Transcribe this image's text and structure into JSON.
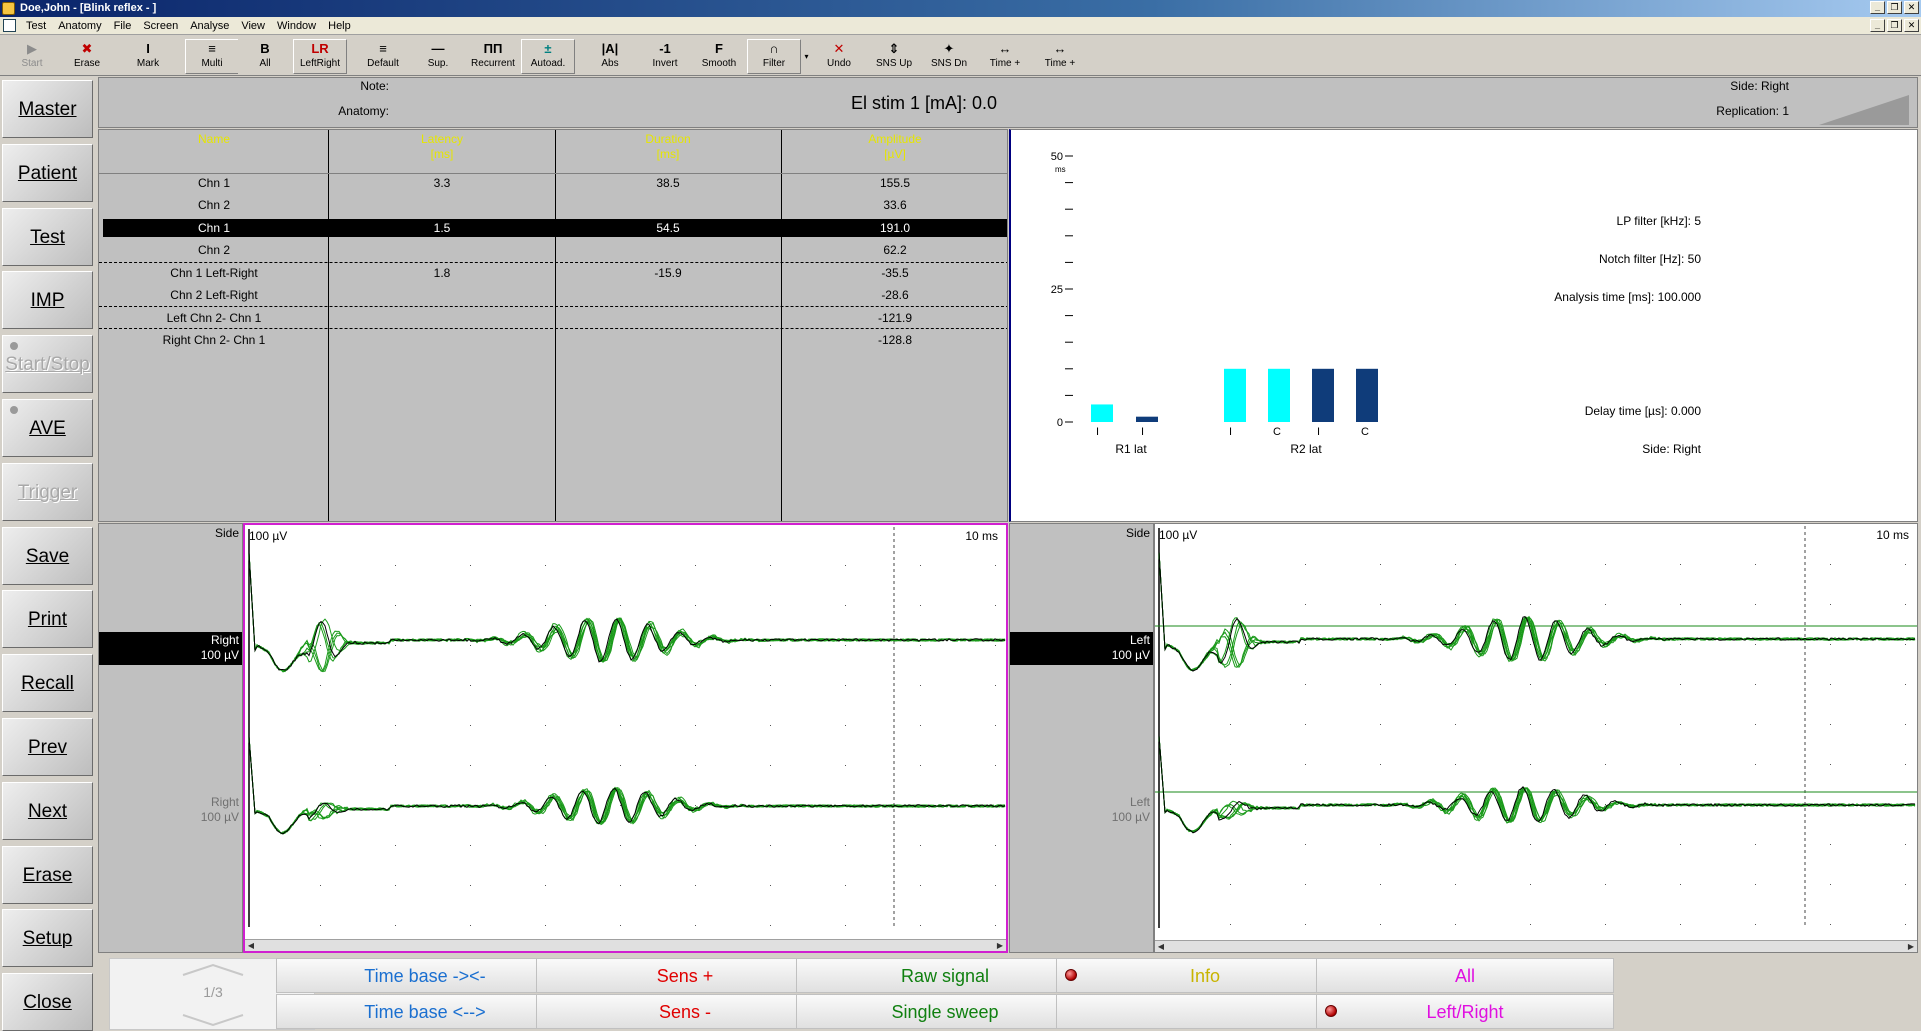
{
  "window": {
    "title": "Doe,John - [Blink reflex - ]"
  },
  "menu": [
    "Test",
    "Anatomy",
    "File",
    "Screen",
    "Analyse",
    "View",
    "Window",
    "Help"
  ],
  "toolbar": [
    {
      "icon": "▶",
      "label": "Start",
      "disabled": true,
      "color": "#8c8c8c"
    },
    {
      "icon": "✖",
      "label": "Erase",
      "color": "#c00000"
    },
    {
      "icon": "I",
      "label": "Mark",
      "color": "#000"
    },
    {
      "icon": "≡",
      "label": "Multi",
      "color": "#000",
      "raised": true
    },
    {
      "icon": "B",
      "label": "All",
      "color": "#000"
    },
    {
      "icon": "LR",
      "label": "LeftRight",
      "color": "#c00000",
      "raised": true
    },
    {
      "icon": "≡",
      "label": "Default",
      "color": "#000"
    },
    {
      "icon": "—",
      "label": "Sup.",
      "color": "#000"
    },
    {
      "icon": "ΠΠ",
      "label": "Recurrent",
      "color": "#000"
    },
    {
      "icon": "±",
      "label": "Autoad.",
      "color": "#008080",
      "raised": true
    },
    {
      "icon": "|A|",
      "label": "Abs",
      "color": "#000"
    },
    {
      "icon": "-1",
      "label": "Invert",
      "color": "#000"
    },
    {
      "icon": "F",
      "label": "Smooth",
      "color": "#000"
    },
    {
      "icon": "∩",
      "label": "Filter",
      "color": "#000",
      "raised": true
    },
    {
      "icon": "✕",
      "label": "Undo",
      "color": "#c00000"
    },
    {
      "icon": "⇕",
      "label": "SNS Up",
      "color": "#000"
    },
    {
      "icon": "✦",
      "label": "SNS Dn",
      "color": "#000"
    },
    {
      "icon": "↔",
      "label": "Time +",
      "color": "#000"
    },
    {
      "icon": "↔",
      "label": "Time +",
      "color": "#000"
    }
  ],
  "side_buttons": [
    {
      "label": "Master",
      "disabled": false,
      "led": false
    },
    {
      "label": "Patient",
      "disabled": false,
      "led": false
    },
    {
      "label": "Test",
      "disabled": false,
      "led": false
    },
    {
      "label": "IMP",
      "disabled": false,
      "led": false
    },
    {
      "label": "Start/Stop",
      "disabled": true,
      "led": true
    },
    {
      "label": "AVE",
      "disabled": false,
      "led": true
    },
    {
      "label": "Trigger",
      "disabled": true,
      "led": false
    },
    {
      "label": "Save",
      "disabled": false,
      "led": false
    },
    {
      "label": "Print",
      "disabled": false,
      "led": false
    },
    {
      "label": "Recall",
      "disabled": false,
      "led": false
    },
    {
      "label": "Prev",
      "disabled": false,
      "led": false
    },
    {
      "label": "Next",
      "disabled": false,
      "led": false
    },
    {
      "label": "Erase",
      "disabled": false,
      "led": false
    },
    {
      "label": "Setup",
      "disabled": false,
      "led": false
    },
    {
      "label": "Close",
      "disabled": false,
      "led": false
    }
  ],
  "header": {
    "note_label": "Note:",
    "anatomy_label": "Anatomy:",
    "stimulus": "El stim 1 [mA]: 0.0",
    "side": "Side: Right",
    "replication": "Replication: 1"
  },
  "table": {
    "headers": [
      {
        "line1": "Name",
        "line2": ""
      },
      {
        "line1": "Latency",
        "line2": "[ms]"
      },
      {
        "line1": "Duration",
        "line2": "[ms]"
      },
      {
        "line1": "Amplitude",
        "line2": "[µV]"
      }
    ],
    "rows": [
      {
        "name": "Chn 1",
        "latency": "3.3",
        "duration": "38.5",
        "amplitude": "155.5",
        "selected": false
      },
      {
        "name": "Chn 2",
        "latency": "",
        "duration": "",
        "amplitude": "33.6",
        "selected": false
      },
      {
        "name": "Chn 1",
        "latency": "1.5",
        "duration": "54.5",
        "amplitude": "191.0",
        "selected": true
      },
      {
        "name": "Chn 2",
        "latency": "",
        "duration": "",
        "amplitude": "62.2",
        "selected": false
      },
      {
        "name": "Chn 1  Left-Right",
        "latency": "1.8",
        "duration": "-15.9",
        "amplitude": "-35.5",
        "selected": false
      },
      {
        "name": "Chn 2  Left-Right",
        "latency": "",
        "duration": "",
        "amplitude": "-28.6",
        "selected": false
      },
      {
        "name": "Left  Chn 2- Chn 1",
        "latency": "",
        "duration": "",
        "amplitude": "-121.9",
        "selected": false
      },
      {
        "name": "Right  Chn 2- Chn 1",
        "latency": "",
        "duration": "",
        "amplitude": "-128.8",
        "selected": false
      }
    ]
  },
  "bar_chart": {
    "y_unit": "ms",
    "y_ticks": [
      0,
      25,
      50
    ],
    "bars": [
      {
        "tick": "I",
        "value": 3.3,
        "color": "#00ffff"
      },
      {
        "tick": "I",
        "value": 1.0,
        "color": "#0f3c7a"
      },
      {
        "tick": "I",
        "value": 10.0,
        "color": "#00ffff"
      },
      {
        "tick": "C",
        "value": 10.0,
        "color": "#00ffff"
      },
      {
        "tick": "I",
        "value": 10.0,
        "color": "#0f3c7a"
      },
      {
        "tick": "C",
        "value": 10.0,
        "color": "#0f3c7a"
      }
    ],
    "group_labels": [
      "R1 lat",
      "R2 lat"
    ]
  },
  "info": {
    "lp_filter": "LP filter [kHz]: 5",
    "notch_filter": "Notch filter [Hz]: 50",
    "analysis_time": "Analysis time [ms]: 100.000",
    "delay_time": "Delay time [µs]: 0.000",
    "side": "Side: Right"
  },
  "traces": {
    "left": {
      "side_header": "Side",
      "ch1_label_side": "Right",
      "ch1_label_sens": "100 µV",
      "ch2_label_side": "Right",
      "ch2_label_sens": "100 µV",
      "scale_label": "100 µV",
      "time_label": "10 ms"
    },
    "right": {
      "side_header": "Side",
      "ch1_label_side": "Left",
      "ch1_label_sens": "100 µV",
      "ch2_label_side": "Left",
      "ch2_label_sens": "100 µV",
      "scale_label": "100 µV",
      "time_label": "10 ms"
    },
    "colors": {
      "trace": "#1a9a1a",
      "average": "#000000",
      "baseline": "#1a8a1a",
      "active_border": "#d020d0"
    }
  },
  "page": {
    "indicator": "1/3"
  },
  "function_keys": [
    {
      "label": "Time base -><-",
      "color": "#1a6fd0",
      "led": false
    },
    {
      "label": "Time base <-->",
      "color": "#1a6fd0",
      "led": false
    },
    {
      "label": "Sens +",
      "color": "#e00000",
      "led": false
    },
    {
      "label": "Sens -",
      "color": "#e00000",
      "led": false
    },
    {
      "label": "Raw signal",
      "color": "#108010",
      "led": false
    },
    {
      "label": "Single sweep",
      "color": "#108010",
      "led": false
    },
    {
      "label": "Info",
      "color": "#c8b400",
      "led": true
    },
    {
      "label": "",
      "color": "#000",
      "led": false
    },
    {
      "label": "All",
      "color": "#e010e0",
      "led": false
    },
    {
      "label": "Left/Right",
      "color": "#e010e0",
      "led": true
    }
  ]
}
